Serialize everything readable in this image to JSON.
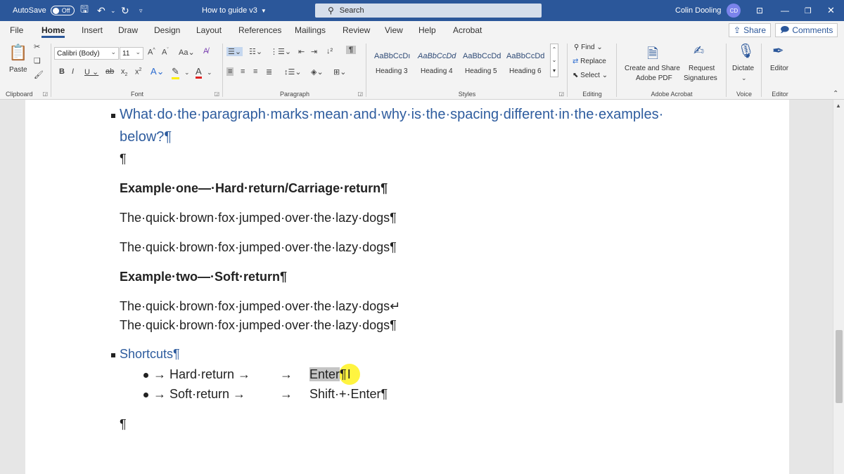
{
  "titlebar": {
    "autosave_label": "AutoSave",
    "autosave_state": "Off",
    "doc_title": "How to guide v3",
    "search_placeholder": "Search",
    "user_name": "Colin Dooling",
    "user_initials": "CD"
  },
  "tabs": [
    "File",
    "Home",
    "Insert",
    "Draw",
    "Design",
    "Layout",
    "References",
    "Mailings",
    "Review",
    "View",
    "Help",
    "Acrobat"
  ],
  "active_tab": "Home",
  "share_label": "Share",
  "comments_label": "Comments",
  "ribbon": {
    "paste_label": "Paste",
    "clipboard_label": "Clipboard",
    "font_name": "Calibri (Body)",
    "font_size": "11",
    "font_label": "Font",
    "paragraph_label": "Paragraph",
    "styles_samples_top": [
      "AaBbCcDı",
      "AaBbCcDd",
      "AaBbCcDd",
      "AaBbCcDd"
    ],
    "styles_names_bottom": [
      "Heading 3",
      "Heading 4",
      "Heading 5",
      "Heading 6"
    ],
    "styles_label": "Styles",
    "find_label": "Find",
    "replace_label": "Replace",
    "select_label": "Select",
    "editing_label": "Editing",
    "create_share_label_1": "Create and Share",
    "create_share_label_2": "Adobe PDF",
    "request_sig_label_1": "Request",
    "request_sig_label_2": "Signatures",
    "adobe_label": "Adobe Acrobat",
    "dictate_label": "Dictate",
    "voice_label": "Voice",
    "editor_label": "Editor",
    "editor_group_label": "Editor"
  },
  "document": {
    "heading1_line1": "What·do·the·paragraph·marks·mean·and·why·is·the·spacing·different·in·the·examples·",
    "heading1_line2": "below?¶",
    "empty_para1": "¶",
    "example_one": "Example·one—·Hard·return/Carriage·return¶",
    "line_a": "The·quick·brown·fox·jumped·over·the·lazy·dogs¶",
    "line_b": "The·quick·brown·fox·jumped·over·the·lazy·dogs¶",
    "example_two": "Example·two—·Soft·return¶",
    "line_c": "The·quick·brown·fox·jumped·over·the·lazy·dogs↵",
    "line_d": "The·quick·brown·fox·jumped·over·the·lazy·dogs¶",
    "shortcuts": "Shortcuts¶",
    "shortcut_items": [
      {
        "label": "→ Hard·return →",
        "arrow": "→",
        "key": "Enter",
        "key_end": "¶"
      },
      {
        "label": "→ Soft·return →",
        "arrow": "→",
        "key": "Shift·+·Enter¶",
        "key_end": ""
      }
    ],
    "empty_para2": "¶"
  }
}
